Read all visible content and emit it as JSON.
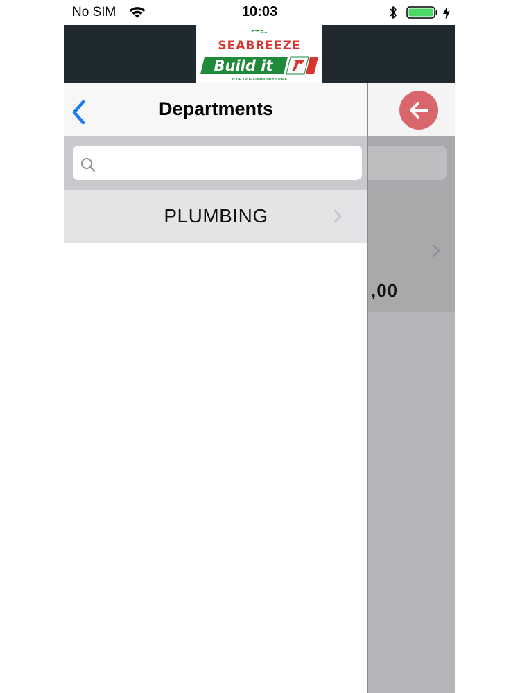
{
  "status_bar": {
    "carrier": "No SIM",
    "time": "10:03"
  },
  "banner": {
    "logo_top": "SEABREEZE",
    "logo_main": "Build it",
    "logo_tag": "YOUR TRUE COMMUNITY STORE",
    "colors": {
      "banner_bg": "#1f2a30",
      "logo_red": "#d6362f",
      "logo_green": "#1e8a3a"
    }
  },
  "sidebar": {
    "title": "Departments",
    "back_icon": "chevron-left-icon",
    "search": {
      "placeholder": "",
      "value": "",
      "icon": "search-icon"
    },
    "items": [
      {
        "label": "PLUMBING",
        "icon": "chevron-right-icon"
      }
    ]
  },
  "background_panel": {
    "back_button_icon": "arrow-left-icon",
    "price_fragment": ",00",
    "accent": "#d9666c"
  }
}
